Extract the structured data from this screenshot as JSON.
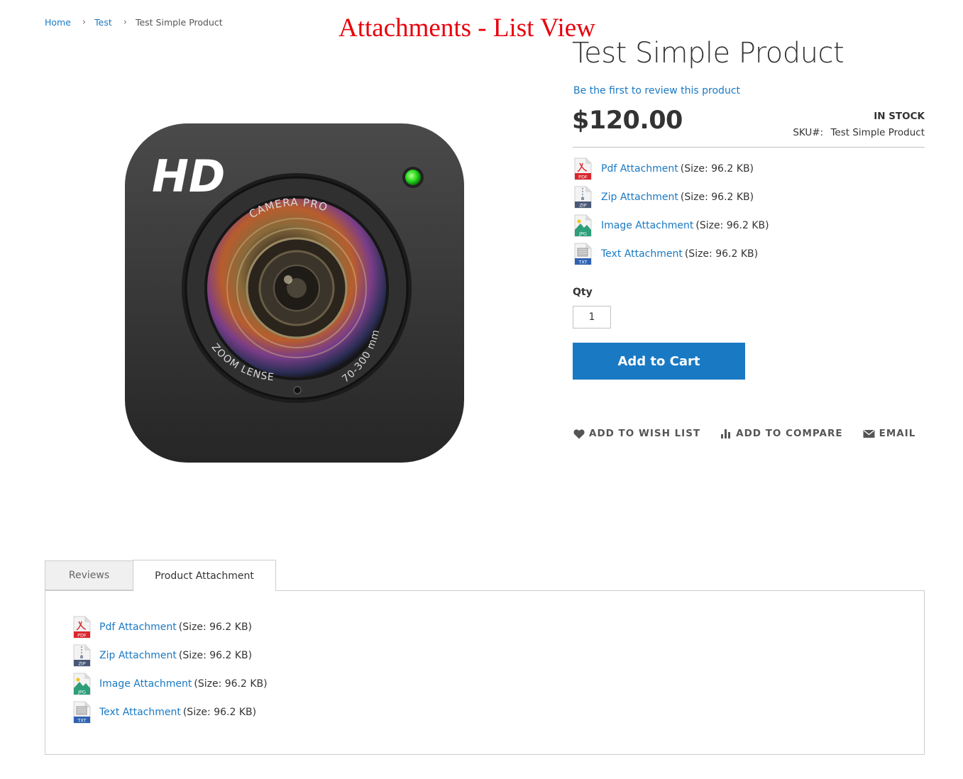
{
  "banner": "Attachments - List View",
  "breadcrumb": {
    "home": "Home",
    "category": "Test",
    "current": "Test Simple Product"
  },
  "product": {
    "title": "Test Simple Product",
    "review_link": "Be the first to review this product",
    "price": "$120.00",
    "stock": "IN STOCK",
    "sku_label": "SKU#:",
    "sku_value": "Test Simple Product",
    "image_hd_text": "HD",
    "image_ring_top": "CAMERA  PRO",
    "image_ring_right": "70-300 mm",
    "image_ring_left": "ZOOM LENSE"
  },
  "attachments": [
    {
      "icon": "pdf-file-icon",
      "badge": "PDF",
      "name": "Pdf Attachment",
      "size": "(Size: 96.2 KB)"
    },
    {
      "icon": "zip-file-icon",
      "badge": "ZIP",
      "name": "Zip Attachment",
      "size": "(Size: 96.2 KB)"
    },
    {
      "icon": "jpg-file-icon",
      "badge": "JPG",
      "name": "Image Attachment",
      "size": "(Size: 96.2 KB)"
    },
    {
      "icon": "txt-file-icon",
      "badge": "TXT",
      "name": "Text Attachment",
      "size": "(Size: 96.2 KB)"
    }
  ],
  "qty": {
    "label": "Qty",
    "value": "1"
  },
  "add_to_cart": "Add to Cart",
  "actions": {
    "wishlist": "Add to Wish List",
    "compare": "Add to Compare",
    "email": "Email"
  },
  "tabs": {
    "reviews": "Reviews",
    "attachments": "Product Attachment"
  },
  "colors": {
    "link": "#1979c3",
    "button": "#1979c3",
    "banner": "#e8000b",
    "pdf": "#d9272e",
    "zip": "#4a5876",
    "jpg": "#2c9e7a",
    "txt": "#2f62b3"
  }
}
